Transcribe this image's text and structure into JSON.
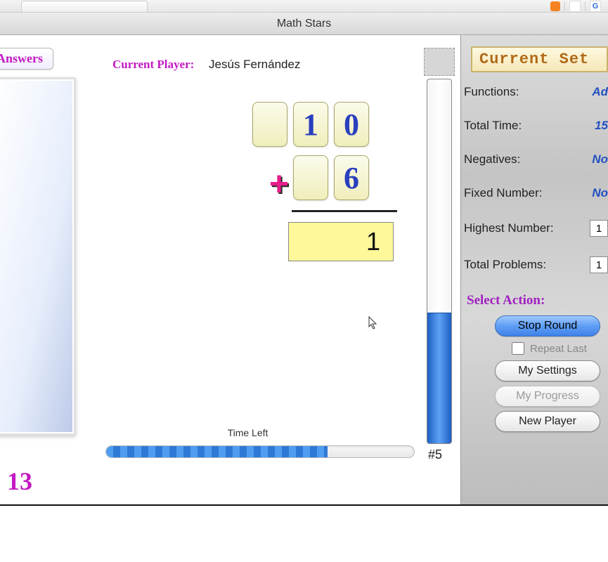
{
  "window": {
    "title": "Math Stars"
  },
  "left": {
    "answers_button": "Answers",
    "score": "13"
  },
  "player": {
    "label": "Current Player:",
    "name": "Jesús Fernández"
  },
  "problem": {
    "top_digits": [
      "",
      "1",
      "0"
    ],
    "bottom_digits": [
      "",
      "6"
    ],
    "operator": "+",
    "answer_value": "1"
  },
  "timer": {
    "label": "Time Left",
    "percent": 72
  },
  "vmeter": {
    "fill_percent": 36,
    "problem_indicator": "#5"
  },
  "settings": {
    "title": "Current Set",
    "rows": {
      "functions": {
        "label": "Functions:",
        "value": "Ad"
      },
      "total_time": {
        "label": "Total Time:",
        "value": "15"
      },
      "negatives": {
        "label": "Negatives:",
        "value": "No"
      },
      "fixed_number": {
        "label": "Fixed Number:",
        "value": "No"
      },
      "highest_number": {
        "label": "Highest Number:",
        "value": "1"
      },
      "total_problems": {
        "label": "Total Problems:",
        "value": "1"
      }
    },
    "select_action_label": "Select Action:",
    "buttons": {
      "stop_round": "Stop Round",
      "repeat_last": "Repeat Last",
      "my_settings": "My Settings",
      "my_progress": "My Progress",
      "new_player": "New Player"
    }
  }
}
